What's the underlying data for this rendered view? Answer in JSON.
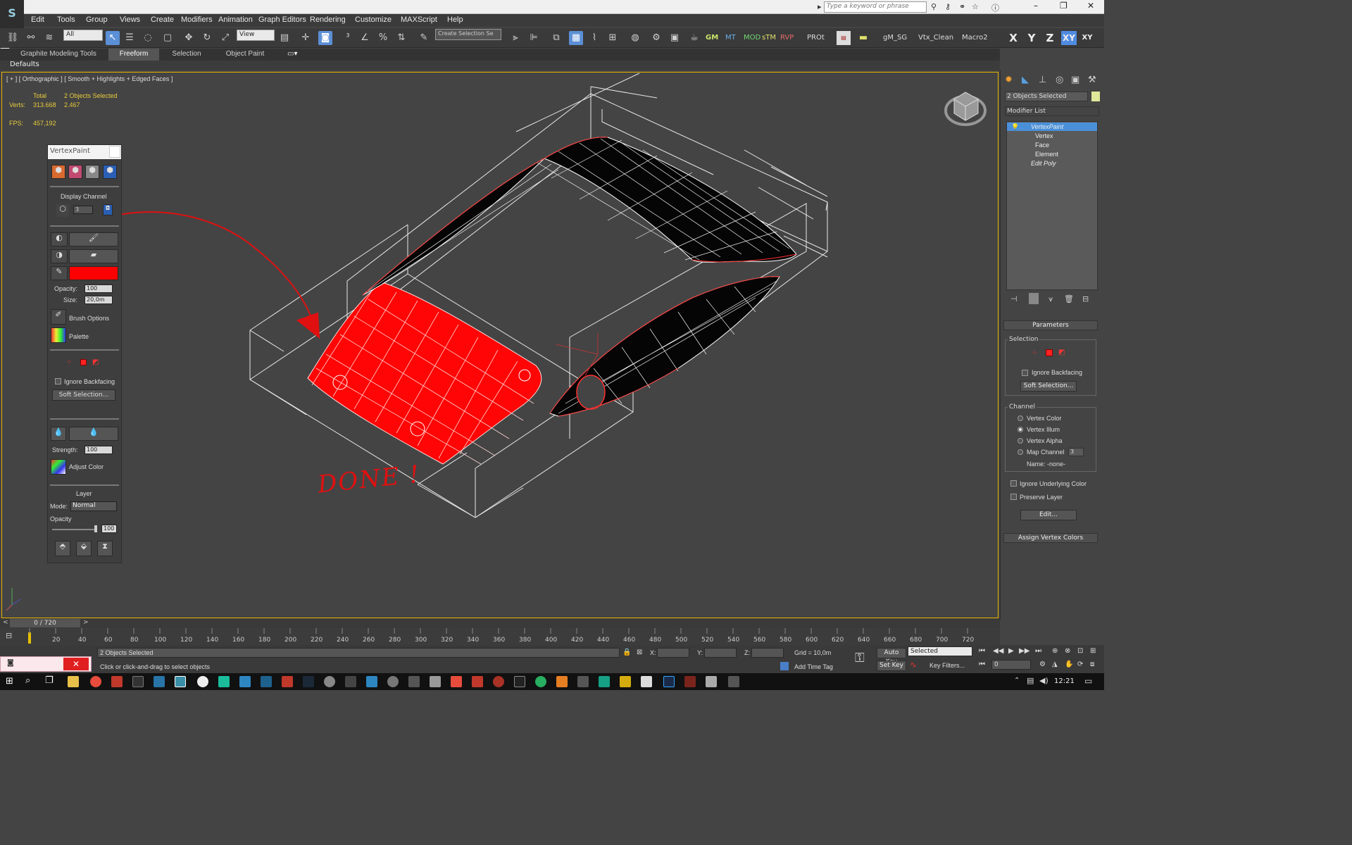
{
  "app": {
    "logo": "S",
    "search_placeholder": "Type a keyword or phrase"
  },
  "menu": [
    "Edit",
    "Tools",
    "Group",
    "Views",
    "Create",
    "Modifiers",
    "Animation",
    "Graph Editors",
    "Rendering",
    "Customize",
    "MAXScript",
    "Help"
  ],
  "toolbar": {
    "filter_select": "All",
    "ref_coord_select": "View",
    "named_sel_select": "Create Selection Se",
    "text_buttons": [
      "GM",
      "MT",
      "MOD",
      "sTM",
      "RVP",
      "PROt",
      "gM_SG",
      "Vtx_Clean",
      "Macro2"
    ],
    "axes": [
      "X",
      "Y",
      "Z",
      "XY",
      "XY"
    ]
  },
  "ribbon": {
    "tabs": [
      "Graphite Modeling Tools",
      "Freeform",
      "Selection",
      "Object Paint"
    ],
    "active_tab": "Freeform",
    "defaults_label": "Defaults"
  },
  "viewport": {
    "label": "[ + ] [ Orthographic ] [ Smooth + Highlights + Edged Faces ]",
    "stats": {
      "total_label": "Total",
      "selection_label": "2 Objects Selected",
      "verts_label": "Verts:",
      "verts_total": "313.668",
      "verts_selected": "2.467",
      "fps_label": "FPS:",
      "fps_value": "457,192"
    },
    "annotation": "DONE !",
    "annotation_color": "#e01010"
  },
  "vertexpaint": {
    "title": "VertexPaint",
    "display_channel_label": "Display Channel",
    "channel_value": "3",
    "paint_color": "#ff0000",
    "opacity_label": "Opacity:",
    "opacity_value": "100",
    "size_label": "Size:",
    "size_value": "20,0m",
    "brush_options_label": "Brush Options",
    "palette_label": "Palette",
    "ignore_backfacing_label": "Ignore Backfacing",
    "soft_selection_label": "Soft Selection...",
    "strength_label": "Strength:",
    "strength_value": "100",
    "adjust_color_label": "Adjust Color",
    "layer_label": "Layer",
    "mode_label": "Mode:",
    "mode_value": "Normal",
    "layer_opacity_label": "Opacity",
    "layer_opacity_value": "100"
  },
  "command_panel": {
    "object_name": "2 Objects Selected",
    "modifier_list": "Modifier List",
    "stack": [
      {
        "label": "VertexPaint",
        "level": 0,
        "active": true
      },
      {
        "label": "Vertex",
        "level": 1
      },
      {
        "label": "Face",
        "level": 1
      },
      {
        "label": "Element",
        "level": 1
      },
      {
        "label": "Edit Poly",
        "level": 0
      }
    ],
    "parameters_label": "Parameters",
    "selection_group": "Selection",
    "ignore_backfacing_label": "Ignore Backfacing",
    "soft_selection_label": "Soft Selection...",
    "channel_group": "Channel",
    "channels": [
      "Vertex Color",
      "Vertex Illum",
      "Vertex Alpha",
      "Map Channel"
    ],
    "selected_channel": 1,
    "map_channel_value": "3",
    "name_label": "Name: -none-",
    "ignore_underlying_label": "Ignore Underlying Color",
    "preserve_layer_label": "Preserve Layer",
    "edit_label": "Edit...",
    "assign_label": "Assign Vertex Colors"
  },
  "timeline": {
    "frame_display": "0 / 720",
    "ticks": [
      "20",
      "40",
      "60",
      "80",
      "100",
      "120",
      "140",
      "160",
      "180",
      "200",
      "220",
      "240",
      "260",
      "280",
      "300",
      "320",
      "340",
      "360",
      "380",
      "400",
      "420",
      "440",
      "460",
      "480",
      "500",
      "520",
      "540",
      "560",
      "580",
      "600",
      "620",
      "640",
      "660",
      "680",
      "700",
      "720"
    ]
  },
  "status": {
    "selection": "2 Objects Selected",
    "prompt": "Click or click-and-drag to select objects",
    "x_label": "X:",
    "y_label": "Y:",
    "z_label": "Z:",
    "grid": "Grid = 10,0m",
    "add_time_tag": "Add Time Tag",
    "auto_key": "Auto Key",
    "set_key": "Set Key",
    "key_mode": "Selected",
    "key_filters": "Key Filters...",
    "frame_value": "0"
  },
  "taskbar": {
    "clock": "12:21"
  }
}
